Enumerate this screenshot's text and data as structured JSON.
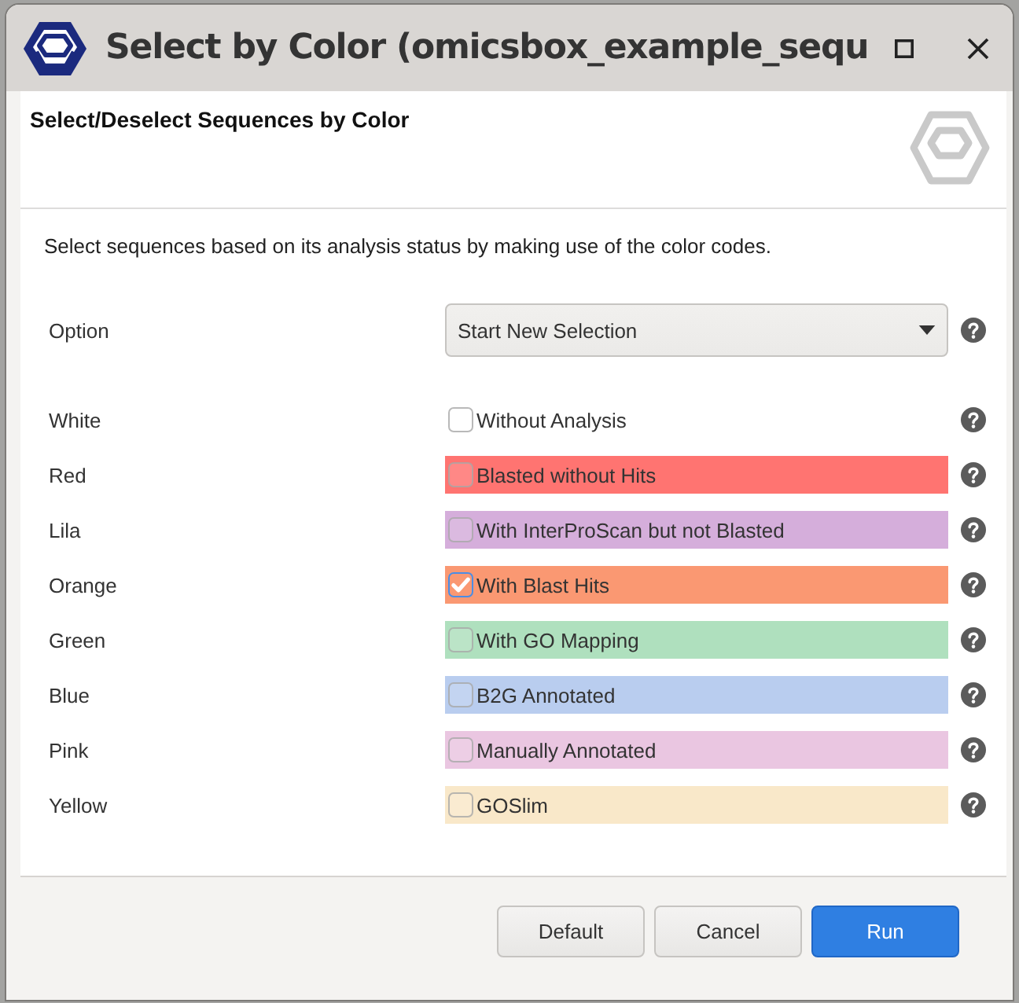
{
  "window": {
    "title": "Select by Color (omicsbox_example_sequ"
  },
  "header": {
    "title": "Select/Deselect Sequences by Color"
  },
  "description": "Select sequences based on its analysis status by making use of the color codes.",
  "option": {
    "label": "Option",
    "value": "Start New Selection"
  },
  "colors": [
    {
      "name": "White",
      "label": "Without Analysis",
      "color": "#ffffff",
      "checked": false
    },
    {
      "name": "Red",
      "label": "Blasted without Hits",
      "color": "#ff7471",
      "checked": false
    },
    {
      "name": "Lila",
      "label": "With InterProScan but not Blasted",
      "color": "#d5aedb",
      "checked": false
    },
    {
      "name": "Orange",
      "label": "With Blast Hits",
      "color": "#fa9872",
      "checked": true
    },
    {
      "name": "Green",
      "label": "With GO Mapping",
      "color": "#afe0be",
      "checked": false
    },
    {
      "name": "Blue",
      "label": "B2G Annotated",
      "color": "#b9cdef",
      "checked": false
    },
    {
      "name": "Pink",
      "label": "Manually Annotated",
      "color": "#eac6e1",
      "checked": false
    },
    {
      "name": "Yellow",
      "label": "GOSlim",
      "color": "#f9e8c9",
      "checked": false
    }
  ],
  "buttons": [
    {
      "label": "Default",
      "kind": "secondary"
    },
    {
      "label": "Cancel",
      "kind": "secondary"
    },
    {
      "label": "Run",
      "kind": "primary"
    }
  ]
}
